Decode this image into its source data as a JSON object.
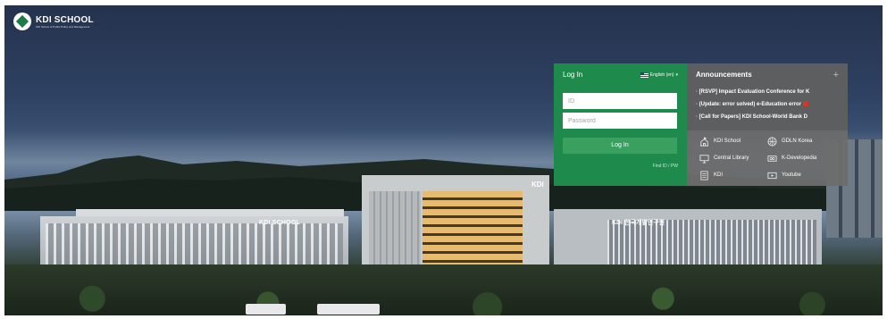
{
  "logo": {
    "name": "KDI SCHOOL",
    "subtitle": "KDI School of Public Policy and Management"
  },
  "building_signs": {
    "left": "KDI SCHOOL",
    "center": "KDI",
    "right": "KDI 한국개발연구원"
  },
  "login": {
    "title": "Log In",
    "language": "English (en)",
    "id_placeholder": "ID",
    "password_placeholder": "Password",
    "button": "Log In",
    "find": "Find ID / PW"
  },
  "announcements": {
    "title": "Announcements",
    "more": "+",
    "items": [
      "[RSVP] Impact Evaluation Conference for K",
      "(Update: error solved) e-Education error",
      "[Call for Papers] KDI School-World Bank D"
    ]
  },
  "links": [
    {
      "label": "KDI School",
      "icon": "school-icon"
    },
    {
      "label": "GDLN Korea",
      "icon": "globe-icon"
    },
    {
      "label": "Central Library",
      "icon": "monitor-icon"
    },
    {
      "label": "K-Developedia",
      "icon": "k-developedia-icon"
    },
    {
      "label": "KDI",
      "icon": "document-icon"
    },
    {
      "label": "Youtube",
      "icon": "play-icon"
    }
  ]
}
